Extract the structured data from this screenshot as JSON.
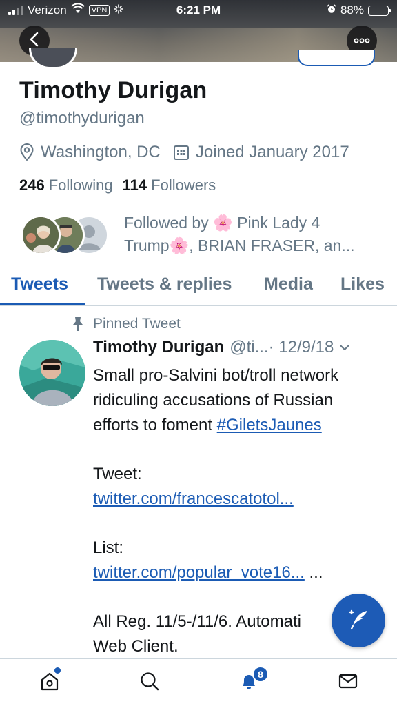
{
  "status_bar": {
    "carrier": "Verizon",
    "vpn": "VPN",
    "time": "6:21 PM",
    "battery": "88%",
    "battery_level": 0.88
  },
  "header": {
    "back_icon": "chevron-left-icon",
    "more_icon": "ellipsis-icon"
  },
  "profile": {
    "name": "Timothy Durigan",
    "handle": "@timothydurigan",
    "location": "Washington, DC",
    "joined": "Joined January 2017",
    "following_count": "246",
    "following_label": "Following",
    "followers_count": "114",
    "followers_label": "Followers",
    "followed_by_line1": "Followed by 🌸 Pink Lady 4",
    "followed_by_line2": "Trump🌸, BRIAN FRASER, an..."
  },
  "tabs": [
    {
      "label": "Tweets",
      "active": true
    },
    {
      "label": "Tweets & replies",
      "active": false
    },
    {
      "label": "Media",
      "active": false
    },
    {
      "label": "Likes",
      "active": false
    }
  ],
  "tweet": {
    "pinned_label": "Pinned Tweet",
    "author": "Timothy Durigan",
    "handle": "@ti...",
    "date": "· 12/9/18",
    "body_line1": "Small pro-Salvini bot/troll network",
    "body_line2": "ridiculing accusations of Russian",
    "body_line3_prefix": "efforts to foment ",
    "hashtag": "#GiletsJaunes",
    "tweet_label": "Tweet:",
    "tweet_link": "twitter.com/francescatotol...",
    "list_label": "List:",
    "list_link": "twitter.com/popular_vote16...",
    "list_suffix": " ...",
    "line_reg": "All Reg. 11/5-/11/6. Automati",
    "line_web": "Web Client."
  },
  "fab": {
    "icon": "compose-tweet-icon"
  },
  "bottom_nav": {
    "notifications_badge": "8",
    "items": [
      "home-icon",
      "search-icon",
      "notifications-icon",
      "messages-icon"
    ]
  },
  "colors": {
    "accent": "#1b5bb4",
    "secondary_text": "#657786",
    "primary_text": "#14171a"
  }
}
